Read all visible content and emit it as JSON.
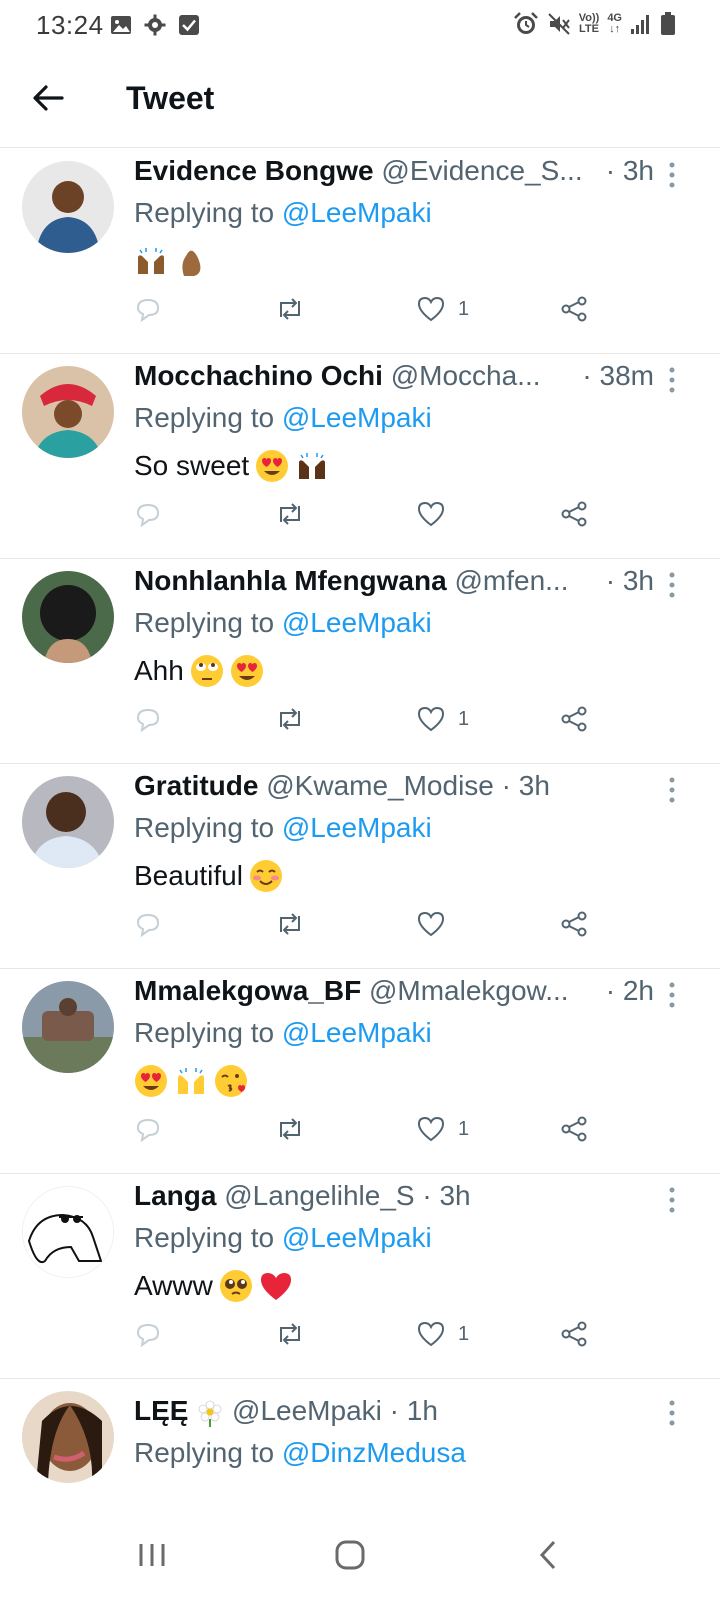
{
  "status_bar": {
    "time": "13:24",
    "left_icons": [
      "gallery-icon",
      "settings-icon",
      "checkbox-icon"
    ],
    "right_icons": [
      "alarm-icon",
      "mute-icon",
      "volte-icon",
      "4g-icon",
      "signal-icon",
      "battery-icon"
    ],
    "volte_label_top": "Vo))",
    "volte_label_bottom": "LTE",
    "network_label": "4G"
  },
  "header": {
    "title": "Tweet"
  },
  "tweets": [
    {
      "name": "Evidence Bongwe",
      "handle": "@Evidence_S...",
      "time": "· 3h",
      "replying_prefix": "Replying to ",
      "replying_to": "@LeeMpaki",
      "text": "",
      "emojis": [
        "raising-hands-icon",
        "pinched-fingers-icon"
      ],
      "likes": "1",
      "avatar_color": "#2f5d8f"
    },
    {
      "name": "Mocchachino Ochi",
      "handle": "@Moccha...",
      "time": "· 38m",
      "replying_prefix": "Replying to ",
      "replying_to": "@LeeMpaki",
      "text": "So sweet",
      "emojis": [
        "heart-eyes-icon",
        "raising-hands-icon"
      ],
      "likes": "",
      "avatar_color": "#c4473f"
    },
    {
      "name": "Nonhlanhla Mfengwana",
      "handle": "@mfen...",
      "time": "· 3h",
      "replying_prefix": "Replying to ",
      "replying_to": "@LeeMpaki",
      "text": "Ahh",
      "emojis": [
        "eye-roll-icon",
        "heart-eyes-icon"
      ],
      "likes": "1",
      "avatar_color": "#3a4a3a"
    },
    {
      "name": "Gratitude",
      "handle": "@Kwame_Modise",
      "time": "· 3h",
      "replying_prefix": "Replying to ",
      "replying_to": "@LeeMpaki",
      "text": "Beautiful",
      "emojis": [
        "smiling-blush-icon"
      ],
      "likes": "",
      "avatar_color": "#6a5a4a"
    },
    {
      "name": "Mmalekgowa_BF",
      "handle": "@Mmalekgow...",
      "time": "· 2h",
      "replying_prefix": "Replying to ",
      "replying_to": "@LeeMpaki",
      "text": "",
      "emojis": [
        "heart-eyes-icon",
        "raising-hands-icon",
        "kiss-icon"
      ],
      "likes": "1",
      "avatar_color": "#7a6a5a"
    },
    {
      "name": "Langa",
      "handle": "@Langelihle_S",
      "time": "· 3h",
      "replying_prefix": "Replying to ",
      "replying_to": "@LeeMpaki",
      "text": "Awww",
      "emojis": [
        "pleading-face-icon",
        "red-heart-icon"
      ],
      "likes": "1",
      "avatar_color": "#ffffff"
    },
    {
      "name": "LĘĘ",
      "handle": "@LeeMpaki",
      "time": "· 1h",
      "replying_prefix": "Replying to ",
      "replying_to": "@DinzMedusa",
      "text": "",
      "emojis": [],
      "likes": "",
      "avatar_color": "#5a3a2a"
    }
  ],
  "nav": {
    "icons": [
      "recents-icon",
      "home-icon",
      "back-icon"
    ]
  },
  "colors": {
    "link": "#1d9bf0",
    "secondary_text": "#536471",
    "primary_text": "#0f1419",
    "divider": "#e6e6e6"
  }
}
